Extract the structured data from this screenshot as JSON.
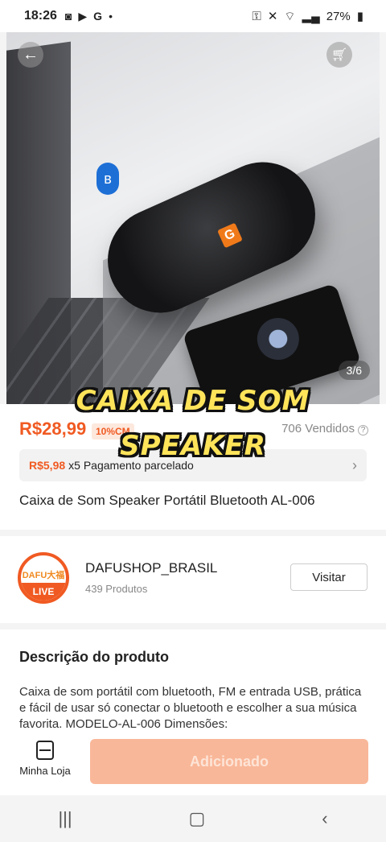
{
  "status_bar": {
    "time": "18:26",
    "notif_icons": [
      "screen-record-icon",
      "youtube-icon",
      "google-icon",
      "dot-icon"
    ],
    "battery": "27%"
  },
  "hero": {
    "image_counter": "3/6",
    "speaker_logo_letter": "G"
  },
  "caption": {
    "line1": "CAIXA DE SOM",
    "line2": "SPEAKER"
  },
  "product": {
    "price": "R$28,99",
    "discount_badge": "10%CM",
    "sold": "706 Vendidos",
    "installment_value": "R$5,98",
    "installment_text": "x5 Pagamento parcelado",
    "title": "Caixa de Som Speaker Portátil Bluetooth AL-006"
  },
  "store": {
    "logo_text": "DAFU大福",
    "live_label": "LIVE",
    "name": "DAFUSHOP_BRASIL",
    "products_count": "439 Produtos",
    "visit_label": "Visitar"
  },
  "description": {
    "heading": "Descrição do produto",
    "text": "Caixa de som portátil com bluetooth, FM e entrada USB, prática e fácil de usar só conectar o bluetooth e escolher a sua música favorita. MODELO-AL-006 Dimensões:"
  },
  "actions": {
    "store_tab_label": "Minha Loja",
    "add_button_label": "Adicionado"
  },
  "colors": {
    "accent": "#f05a22",
    "add_button_disabled": "#f9b799",
    "caption_fill": "#ffe45a"
  }
}
